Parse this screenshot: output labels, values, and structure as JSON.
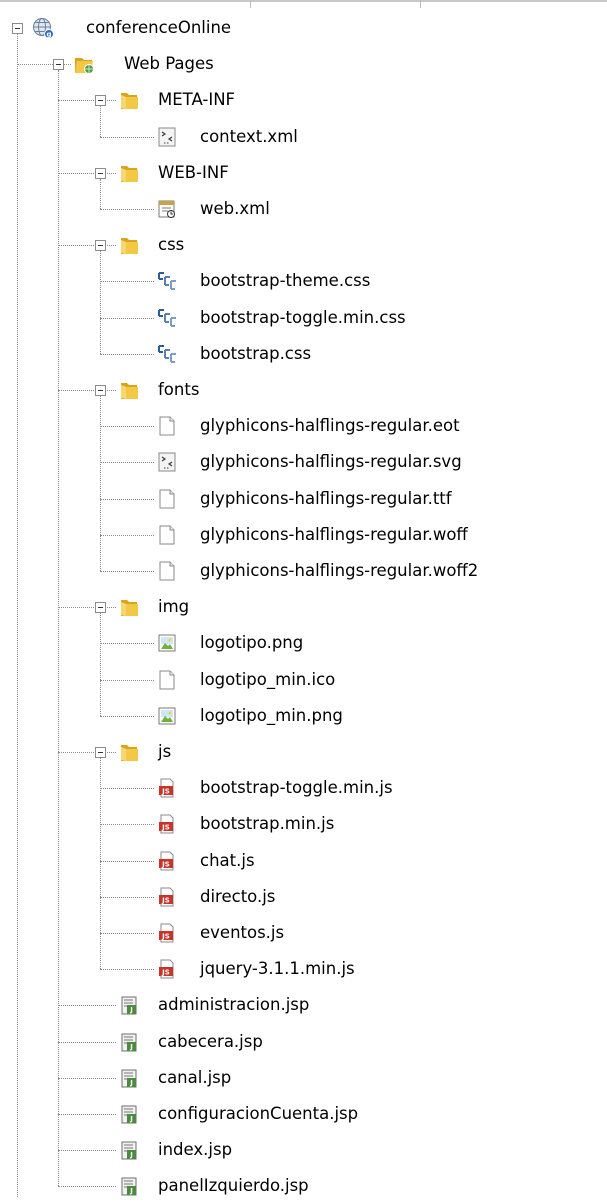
{
  "tree": {
    "root": {
      "label": "conferenceOnline",
      "icon": "globe-project-icon"
    },
    "web_pages": {
      "label": "Web Pages",
      "icon": "web-folder-icon"
    },
    "folders": [
      {
        "id": "meta-inf",
        "label": "META-INF",
        "icon": "folder-icon",
        "files": [
          {
            "label": "context.xml",
            "icon": "xml-config-icon"
          }
        ]
      },
      {
        "id": "web-inf",
        "label": "WEB-INF",
        "icon": "folder-icon",
        "files": [
          {
            "label": "web.xml",
            "icon": "web-xml-icon"
          }
        ]
      },
      {
        "id": "css",
        "label": "css",
        "icon": "folder-icon",
        "files": [
          {
            "label": "bootstrap-theme.css",
            "icon": "css-file-icon"
          },
          {
            "label": "bootstrap-toggle.min.css",
            "icon": "css-file-icon"
          },
          {
            "label": "bootstrap.css",
            "icon": "css-file-icon"
          }
        ]
      },
      {
        "id": "fonts",
        "label": "fonts",
        "icon": "folder-icon",
        "files": [
          {
            "label": "glyphicons-halflings-regular.eot",
            "icon": "blank-file-icon"
          },
          {
            "label": "glyphicons-halflings-regular.svg",
            "icon": "xml-config-icon"
          },
          {
            "label": "glyphicons-halflings-regular.ttf",
            "icon": "blank-file-icon"
          },
          {
            "label": "glyphicons-halflings-regular.woff",
            "icon": "blank-file-icon"
          },
          {
            "label": "glyphicons-halflings-regular.woff2",
            "icon": "blank-file-icon"
          }
        ]
      },
      {
        "id": "img",
        "label": "img",
        "icon": "folder-icon",
        "files": [
          {
            "label": "logotipo.png",
            "icon": "image-file-icon"
          },
          {
            "label": "logotipo_min.ico",
            "icon": "blank-file-icon"
          },
          {
            "label": "logotipo_min.png",
            "icon": "image-file-icon"
          }
        ]
      },
      {
        "id": "js",
        "label": "js",
        "icon": "folder-icon",
        "files": [
          {
            "label": "bootstrap-toggle.min.js",
            "icon": "js-file-icon"
          },
          {
            "label": "bootstrap.min.js",
            "icon": "js-file-icon"
          },
          {
            "label": "chat.js",
            "icon": "js-file-icon"
          },
          {
            "label": "directo.js",
            "icon": "js-file-icon"
          },
          {
            "label": "eventos.js",
            "icon": "js-file-icon"
          },
          {
            "label": "jquery-3.1.1.min.js",
            "icon": "js-file-icon"
          }
        ]
      }
    ],
    "jsp_files": [
      {
        "label": "administracion.jsp",
        "icon": "jsp-file-icon"
      },
      {
        "label": "cabecera.jsp",
        "icon": "jsp-file-icon"
      },
      {
        "label": "canal.jsp",
        "icon": "jsp-file-icon"
      },
      {
        "label": "configuracionCuenta.jsp",
        "icon": "jsp-file-icon"
      },
      {
        "label": "index.jsp",
        "icon": "jsp-file-icon"
      },
      {
        "label": "panelIzquierdo.jsp",
        "icon": "jsp-file-icon"
      }
    ]
  },
  "colors": {
    "folder": "#f3c845",
    "folder_dark": "#d9a520",
    "js_red": "#c8342a",
    "css_blue": "#2a5d9c",
    "image_green": "#6fb23a",
    "guide_line": "#8a8a8a"
  }
}
